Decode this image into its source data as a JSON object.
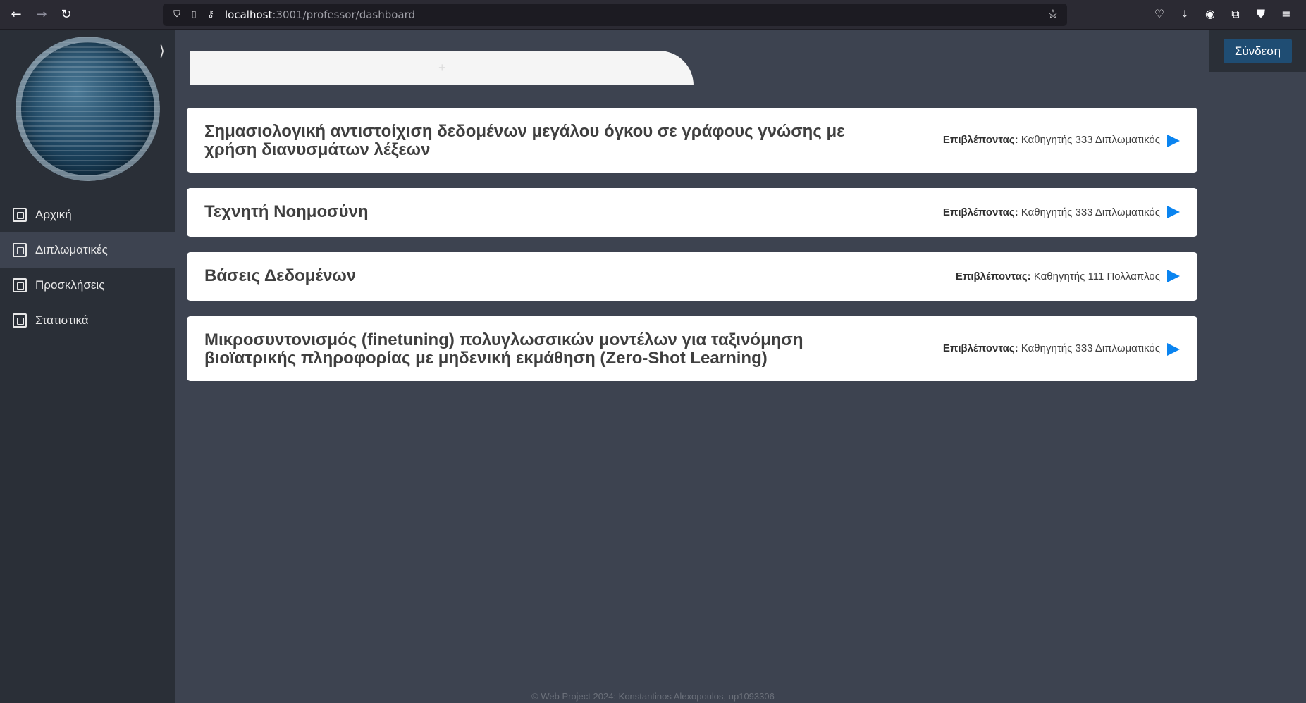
{
  "browser": {
    "url_host": "localhost",
    "url_path": ":3001/professor/dashboard"
  },
  "sidebar": {
    "collapse_symbol": "⟩",
    "items": [
      {
        "label": "Αρχική",
        "icon": "home-icon"
      },
      {
        "label": "Διπλωματικές",
        "icon": "graduation-cap-icon",
        "active": true
      },
      {
        "label": "Προσκλήσεις",
        "icon": "invitation-icon"
      },
      {
        "label": "Στατιστικά",
        "icon": "chart-icon"
      }
    ]
  },
  "header": {
    "login_label": "Σύνδεση"
  },
  "search": {
    "plus_symbol": "+"
  },
  "theses": [
    {
      "title": "Σημασιολογική αντιστοίχιση δεδομένων μεγάλου όγκου σε γράφους γνώσης με χρήση διανυσμάτων λέξεων",
      "supervisor_label": "Επιβλέποντας:",
      "supervisor": "Καθηγητής 333 Διπλωματικός"
    },
    {
      "title": "Τεχνητή Νοημοσύνη",
      "supervisor_label": "Επιβλέποντας:",
      "supervisor": "Καθηγητής 333 Διπλωματικός"
    },
    {
      "title": "Βάσεις Δεδομένων",
      "supervisor_label": "Επιβλέποντας:",
      "supervisor": "Καθηγητής 111 Πολλαπλος"
    },
    {
      "title": "Μικροσυντονισμός (finetuning) πολυγλωσσικών μοντέλων για ταξινόμηση βιοϊατρικής πληροφορίας με μηδενική εκμάθηση (Zero-Shot Learning)",
      "supervisor_label": "Επιβλέποντας:",
      "supervisor": "Καθηγητής 333 Διπλωματικός"
    }
  ],
  "footer": {
    "text": "© Web Project 2024: Konstantinos Alexopoulos, up1093306"
  },
  "colors": {
    "accent": "#0a84f0",
    "login_bg": "#1f4d73",
    "sidebar_bg": "#2a2f37",
    "page_bg": "#3d4350"
  }
}
